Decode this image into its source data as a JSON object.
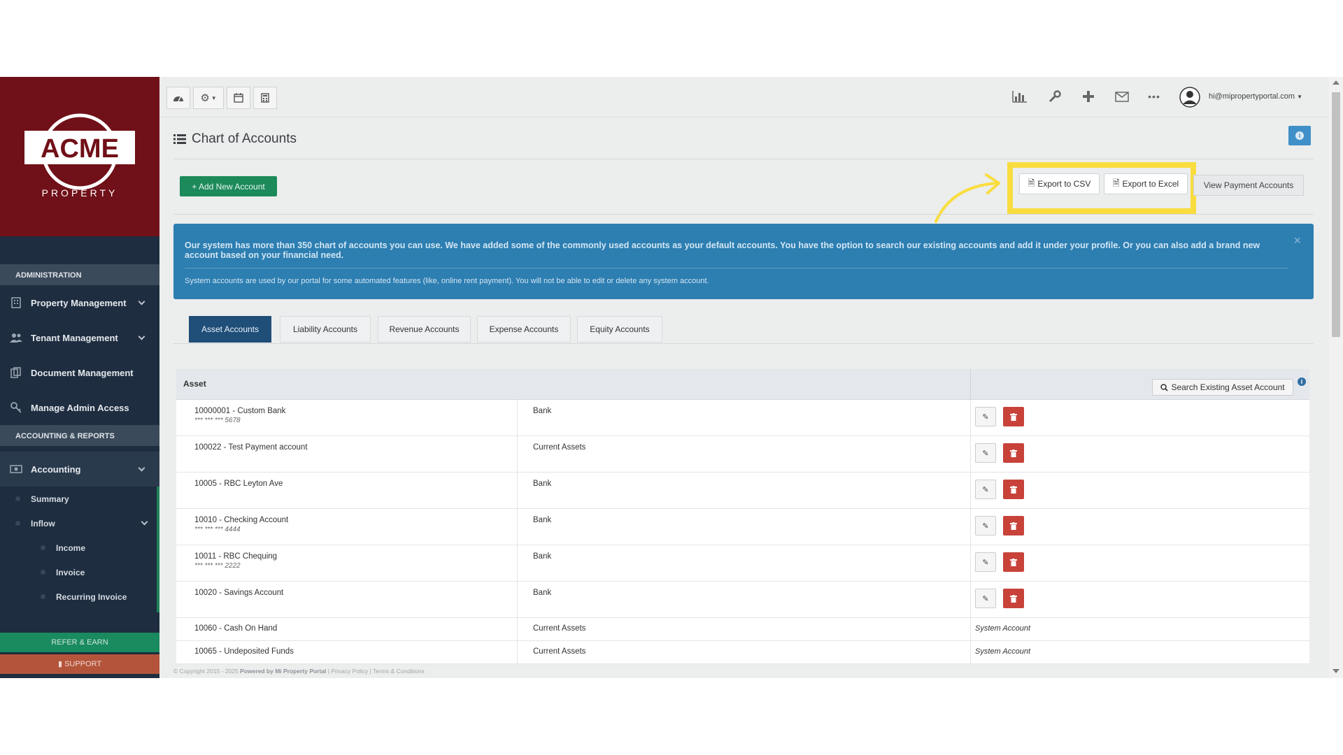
{
  "brand": {
    "logo_top": "ACME",
    "logo_bottom": "PROPERTY",
    "logo_color": "#701018"
  },
  "sidebar": {
    "sections": [
      {
        "heading": "ADMINISTRATION",
        "items": [
          {
            "label": "Property Management",
            "icon": "building-icon"
          },
          {
            "label": "Tenant Management",
            "icon": "users-icon"
          },
          {
            "label": "Document Management",
            "icon": "documents-icon"
          },
          {
            "label": "Manage Admin Access",
            "icon": "key-icon"
          }
        ]
      },
      {
        "heading": "ACCOUNTING & REPORTS",
        "items": [
          {
            "label": "Accounting",
            "icon": "money-icon"
          }
        ]
      }
    ],
    "accounting_sub": {
      "summary": "Summary",
      "inflow": "Inflow",
      "inflow_items": [
        "Income",
        "Invoice",
        "Recurring Invoice"
      ]
    },
    "refer_label": "REFER & EARN",
    "support_label": "SUPPORT"
  },
  "topbar": {
    "left_buttons": [
      "dashboard-icon",
      "gear-icon",
      "calendar-icon",
      "calculator-icon"
    ],
    "right_icons": [
      "bar-chart-icon",
      "wrench-icon",
      "plus-icon",
      "mail-icon",
      "more-icon"
    ],
    "user_email": "hi@mipropertyportal.com"
  },
  "page": {
    "title": "Chart of Accounts",
    "add_button": "+ Add New Account",
    "export_csv": "Export to CSV",
    "export_excel": "Export to Excel",
    "view_payment": "View Payment Accounts",
    "highlight_color": "#f9dd3e"
  },
  "alert": {
    "main_text": "Our system has more than 350 chart of accounts you can use. We have added some of the commonly used accounts as your default accounts. You have the option to search our existing accounts and add it under your profile. Or you can also add a brand new account based on your financial need.",
    "note": "System accounts are used by our portal for some automated features (like, online rent payment). You will not be able to edit or delete any system account.",
    "close": "×"
  },
  "tabs": [
    {
      "label": "Asset Accounts",
      "active": true
    },
    {
      "label": "Liability Accounts",
      "active": false
    },
    {
      "label": "Revenue Accounts",
      "active": false
    },
    {
      "label": "Expense Accounts",
      "active": false
    },
    {
      "label": "Equity Accounts",
      "active": false
    }
  ],
  "table": {
    "header": "Asset",
    "search_label": "Search Existing Asset Account",
    "rows": [
      {
        "name": "10000001 - Custom Bank",
        "mask": "*** *** *** 5678",
        "type": "Bank",
        "system": ""
      },
      {
        "name": "100022 - Test Payment account",
        "mask": "",
        "type": "Current Assets",
        "system": ""
      },
      {
        "name": "10005 - RBC Leyton Ave",
        "mask": "",
        "type": "Bank",
        "system": ""
      },
      {
        "name": "10010 - Checking Account",
        "mask": "*** *** *** 4444",
        "type": "Bank",
        "system": ""
      },
      {
        "name": "10011 - RBC Chequing",
        "mask": "*** *** *** 2222",
        "type": "Bank",
        "system": ""
      },
      {
        "name": "10020 - Savings Account",
        "mask": "",
        "type": "Bank",
        "system": ""
      },
      {
        "name": "10060 - Cash On Hand",
        "mask": "",
        "type": "Current Assets",
        "system": "System Account"
      },
      {
        "name": "10065 - Undeposited Funds",
        "mask": "",
        "type": "Current Assets",
        "system": "System Account"
      }
    ]
  },
  "footer": {
    "copyright": "© Copyright 2015 - 2025",
    "powered": "Powered by Mi Property Portal",
    "privacy": "Privacy Policy",
    "terms": "Terms & Conditions"
  }
}
